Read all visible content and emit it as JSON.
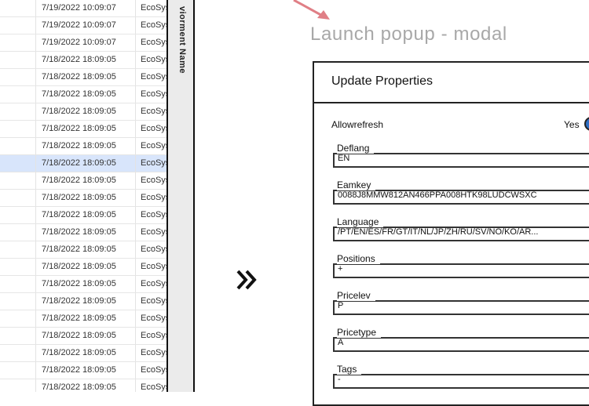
{
  "table": {
    "rows": [
      {
        "date": "7/19/2022 10:09:07",
        "env": "EcoSys"
      },
      {
        "date": "7/19/2022 10:09:07",
        "env": "EcoSys"
      },
      {
        "date": "7/19/2022 10:09:07",
        "env": "EcoSys"
      },
      {
        "date": "7/18/2022 18:09:05",
        "env": "EcoSys"
      },
      {
        "date": "7/18/2022 18:09:05",
        "env": "EcoSys"
      },
      {
        "date": "7/18/2022 18:09:05",
        "env": "EcoSys"
      },
      {
        "date": "7/18/2022 18:09:05",
        "env": "EcoSys"
      },
      {
        "date": "7/18/2022 18:09:05",
        "env": "EcoSys"
      },
      {
        "date": "7/18/2022 18:09:05",
        "env": "EcoSys"
      },
      {
        "date": "7/18/2022 18:09:05",
        "env": "EcoSys"
      },
      {
        "date": "7/18/2022 18:09:05",
        "env": "EcoSys"
      },
      {
        "date": "7/18/2022 18:09:05",
        "env": "EcoSys"
      },
      {
        "date": "7/18/2022 18:09:05",
        "env": "EcoSys"
      },
      {
        "date": "7/18/2022 18:09:05",
        "env": "EcoSys"
      },
      {
        "date": "7/18/2022 18:09:05",
        "env": "EcoSys"
      },
      {
        "date": "7/18/2022 18:09:05",
        "env": "EcoSys"
      },
      {
        "date": "7/18/2022 18:09:05",
        "env": "EcoSys"
      },
      {
        "date": "7/18/2022 18:09:05",
        "env": "EcoSys"
      },
      {
        "date": "7/18/2022 18:09:05",
        "env": "EcoSys"
      },
      {
        "date": "7/18/2022 18:09:05",
        "env": "EcoSys"
      },
      {
        "date": "7/18/2022 18:09:05",
        "env": "EcoSys"
      },
      {
        "date": "7/18/2022 18:09:05",
        "env": "EcoSys"
      },
      {
        "date": "7/18/2022 18:09:05",
        "env": "EcoSys"
      }
    ],
    "selected_index": 9
  },
  "vertical_header": "viorment Name",
  "chevron_icon": "double-chevron-right-icon",
  "arrow_icon": "arrow-down-right-icon",
  "arrow_color": "#e07f86",
  "caption": "Launch popup - modal",
  "modal": {
    "title": "Update Properties",
    "allowrefresh": {
      "label": "Allowrefresh",
      "value": "Yes",
      "on": true,
      "toggle_color": "#2f6fc3"
    },
    "fields": [
      {
        "label": "Deflang",
        "value": "EN"
      },
      {
        "label": "Eamkey",
        "value": "0088J8MMW812AN466PPA008HTK98LUDCWSXC"
      },
      {
        "label": "Language",
        "value": "/PT/EN/ES/FR/GT/IT/NL/JP/ZH/RU/SV/NO/KO/AR..."
      },
      {
        "label": "Positions",
        "value": "+"
      },
      {
        "label": "Pricelev",
        "value": "P"
      },
      {
        "label": "Pricetype",
        "value": "A"
      },
      {
        "label": "Tags",
        "value": "-"
      }
    ]
  }
}
